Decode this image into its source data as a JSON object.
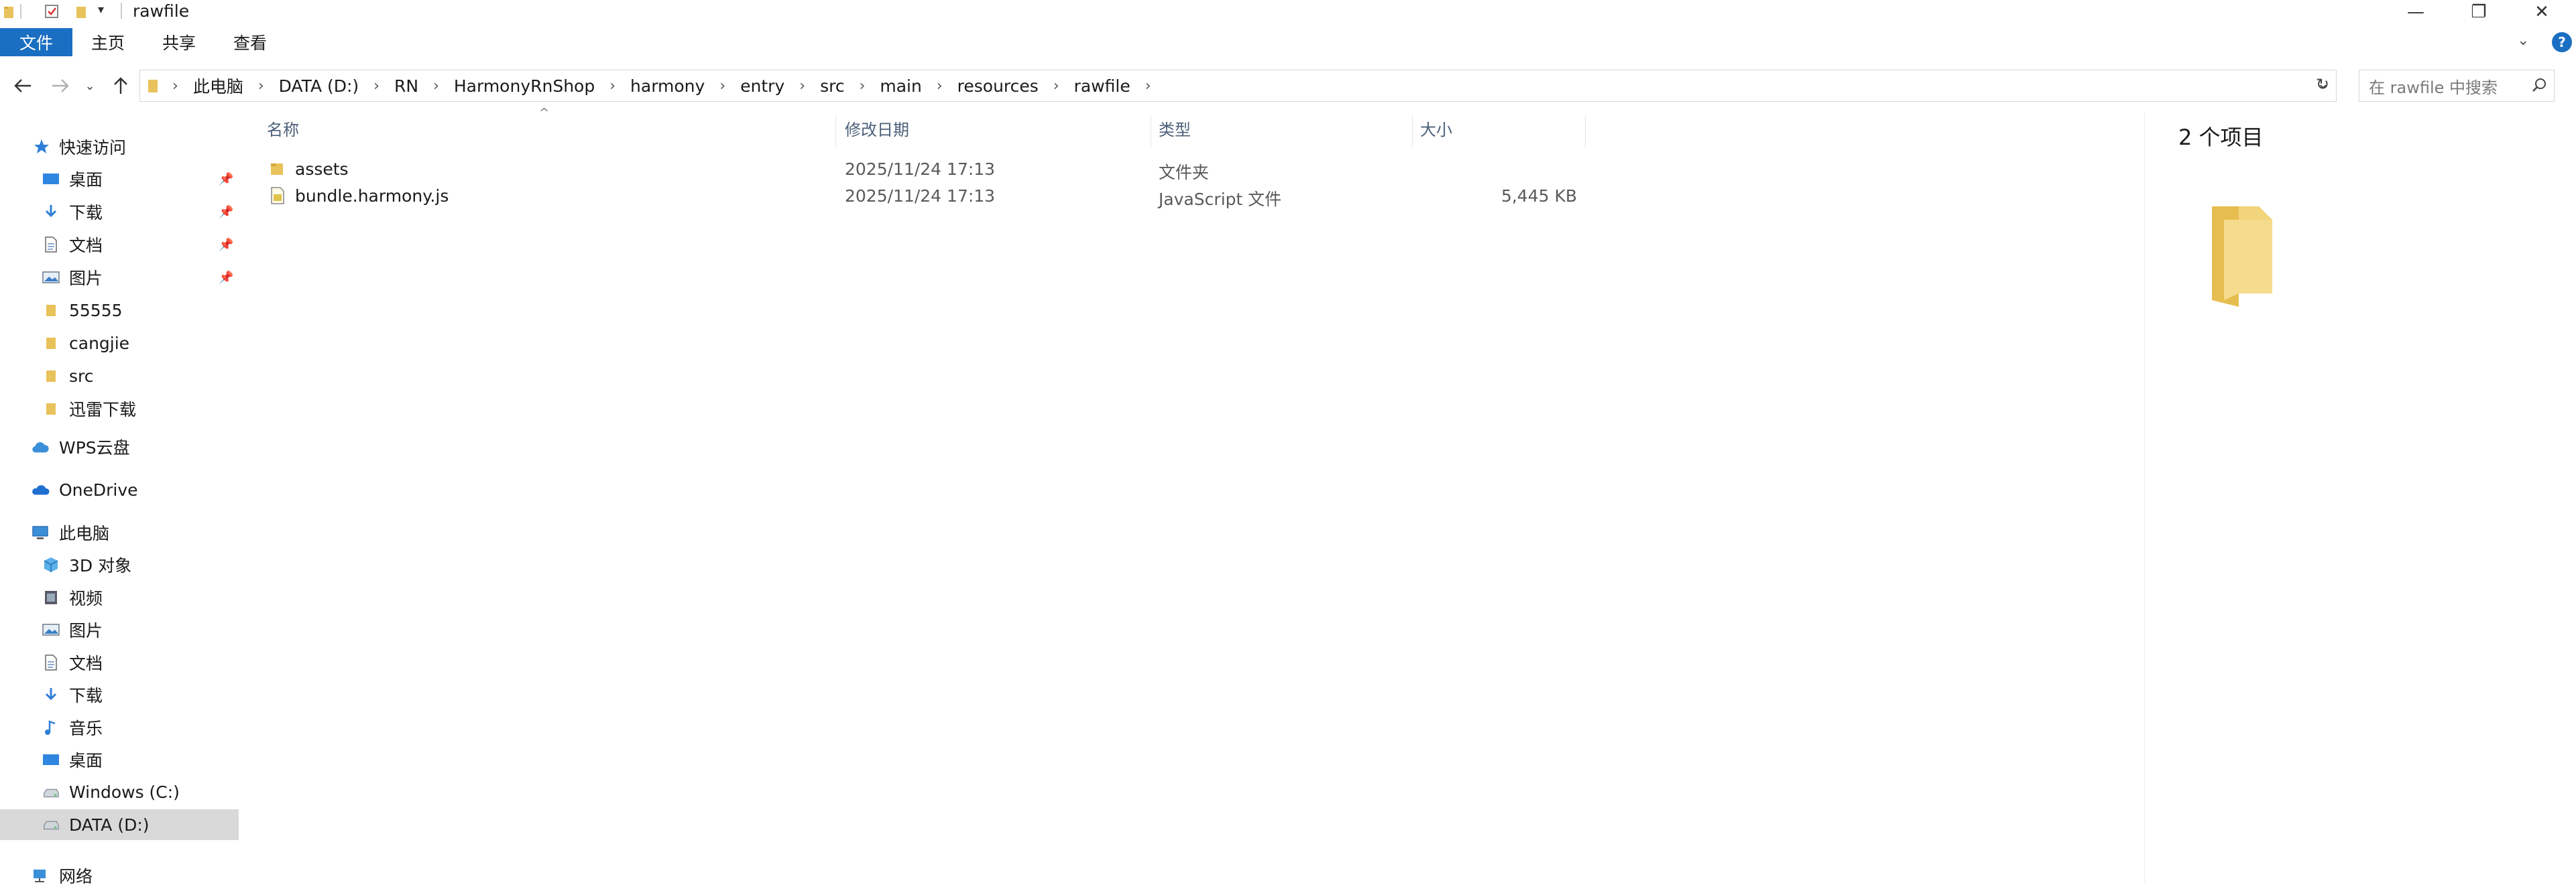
{
  "window": {
    "title": "rawfile",
    "controls": {
      "minimize": "—",
      "restore": "❐",
      "close": "✕"
    }
  },
  "ribbon": {
    "tabs": [
      "文件",
      "主页",
      "共享",
      "查看"
    ],
    "accent": "#1a6fc2",
    "help": "?"
  },
  "address": {
    "breadcrumbs": [
      "此电脑",
      "DATA (D:)",
      "RN",
      "HarmonyRnShop",
      "harmony",
      "entry",
      "src",
      "main",
      "resources",
      "rawfile"
    ],
    "search_placeholder": "在 rawfile 中搜索"
  },
  "nav": {
    "quick_access": "快速访问",
    "quick_items": [
      {
        "label": "桌面",
        "icon": "desktop-icon",
        "pinned": true
      },
      {
        "label": "下载",
        "icon": "download-icon",
        "pinned": true
      },
      {
        "label": "文档",
        "icon": "document-icon",
        "pinned": true
      },
      {
        "label": "图片",
        "icon": "picture-icon",
        "pinned": true
      },
      {
        "label": "55555",
        "icon": "folder-icon",
        "pinned": false
      },
      {
        "label": "cangjie",
        "icon": "folder-icon",
        "pinned": false
      },
      {
        "label": "src",
        "icon": "folder-icon",
        "pinned": false
      },
      {
        "label": "迅雷下载",
        "icon": "folder-icon",
        "pinned": false
      }
    ],
    "wps": "WPS云盘",
    "onedrive": "OneDrive",
    "this_pc": "此电脑",
    "pc_items": [
      {
        "label": "3D 对象",
        "icon": "3d-objects-icon"
      },
      {
        "label": "视频",
        "icon": "video-icon"
      },
      {
        "label": "图片",
        "icon": "picture-icon"
      },
      {
        "label": "文档",
        "icon": "document-icon"
      },
      {
        "label": "下载",
        "icon": "download-icon"
      },
      {
        "label": "音乐",
        "icon": "music-icon"
      },
      {
        "label": "桌面",
        "icon": "desktop-icon"
      },
      {
        "label": "Windows (C:)",
        "icon": "drive-icon"
      },
      {
        "label": "DATA (D:)",
        "icon": "drive-icon",
        "selected": true
      }
    ],
    "network": "网络"
  },
  "filelist": {
    "columns": {
      "name": "名称",
      "modified": "修改日期",
      "type": "类型",
      "size": "大小"
    },
    "rows": [
      {
        "name": "assets",
        "modified": "2025/11/24 17:13",
        "type": "文件夹",
        "size": "",
        "icon": "folder-icon"
      },
      {
        "name": "bundle.harmony.js",
        "modified": "2025/11/24 17:13",
        "type": "JavaScript 文件",
        "size": "5,445 KB",
        "icon": "js-file-icon"
      }
    ]
  },
  "preview": {
    "count": "2 个项目",
    "icon": "large-folder-icon"
  }
}
